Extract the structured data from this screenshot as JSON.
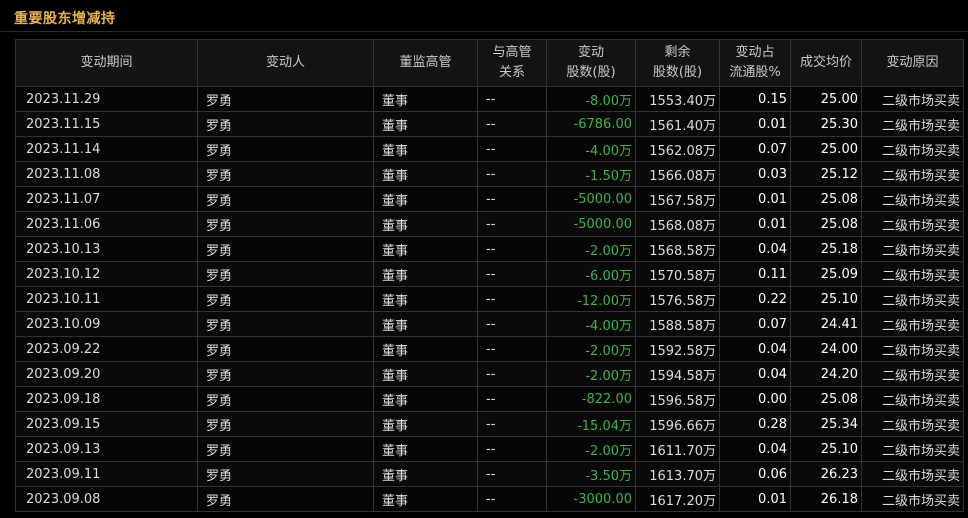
{
  "title": "重要股东增减持",
  "colors": {
    "title": "#e8b44a",
    "decrease": "#3cb54a",
    "text": "#dcdcdc",
    "background": "#000000"
  },
  "columns": [
    {
      "line1": "变动期间",
      "line2": ""
    },
    {
      "line1": "变动人",
      "line2": ""
    },
    {
      "line1": "董监高管",
      "line2": ""
    },
    {
      "line1": "与高管",
      "line2": "关系"
    },
    {
      "line1": "变动",
      "line2": "股数(股)"
    },
    {
      "line1": "剩余",
      "line2": "股数(股)"
    },
    {
      "line1": "变动占",
      "line2": "流通股%"
    },
    {
      "line1": "成交均价",
      "line2": ""
    },
    {
      "line1": "变动原因",
      "line2": ""
    }
  ],
  "rows": [
    {
      "date": "2023.11.29",
      "person": "罗勇",
      "role": "董事",
      "relation": "--",
      "change": "-8.00万",
      "remain": "1553.40万",
      "ratio": "0.15",
      "price": "25.00",
      "reason": "二级市场买卖"
    },
    {
      "date": "2023.11.15",
      "person": "罗勇",
      "role": "董事",
      "relation": "--",
      "change": "-6786.00",
      "remain": "1561.40万",
      "ratio": "0.01",
      "price": "25.30",
      "reason": "二级市场买卖"
    },
    {
      "date": "2023.11.14",
      "person": "罗勇",
      "role": "董事",
      "relation": "--",
      "change": "-4.00万",
      "remain": "1562.08万",
      "ratio": "0.07",
      "price": "25.00",
      "reason": "二级市场买卖"
    },
    {
      "date": "2023.11.08",
      "person": "罗勇",
      "role": "董事",
      "relation": "--",
      "change": "-1.50万",
      "remain": "1566.08万",
      "ratio": "0.03",
      "price": "25.12",
      "reason": "二级市场买卖"
    },
    {
      "date": "2023.11.07",
      "person": "罗勇",
      "role": "董事",
      "relation": "--",
      "change": "-5000.00",
      "remain": "1567.58万",
      "ratio": "0.01",
      "price": "25.08",
      "reason": "二级市场买卖"
    },
    {
      "date": "2023.11.06",
      "person": "罗勇",
      "role": "董事",
      "relation": "--",
      "change": "-5000.00",
      "remain": "1568.08万",
      "ratio": "0.01",
      "price": "25.08",
      "reason": "二级市场买卖"
    },
    {
      "date": "2023.10.13",
      "person": "罗勇",
      "role": "董事",
      "relation": "--",
      "change": "-2.00万",
      "remain": "1568.58万",
      "ratio": "0.04",
      "price": "25.18",
      "reason": "二级市场买卖"
    },
    {
      "date": "2023.10.12",
      "person": "罗勇",
      "role": "董事",
      "relation": "--",
      "change": "-6.00万",
      "remain": "1570.58万",
      "ratio": "0.11",
      "price": "25.09",
      "reason": "二级市场买卖"
    },
    {
      "date": "2023.10.11",
      "person": "罗勇",
      "role": "董事",
      "relation": "--",
      "change": "-12.00万",
      "remain": "1576.58万",
      "ratio": "0.22",
      "price": "25.10",
      "reason": "二级市场买卖"
    },
    {
      "date": "2023.10.09",
      "person": "罗勇",
      "role": "董事",
      "relation": "--",
      "change": "-4.00万",
      "remain": "1588.58万",
      "ratio": "0.07",
      "price": "24.41",
      "reason": "二级市场买卖"
    },
    {
      "date": "2023.09.22",
      "person": "罗勇",
      "role": "董事",
      "relation": "--",
      "change": "-2.00万",
      "remain": "1592.58万",
      "ratio": "0.04",
      "price": "24.00",
      "reason": "二级市场买卖"
    },
    {
      "date": "2023.09.20",
      "person": "罗勇",
      "role": "董事",
      "relation": "--",
      "change": "-2.00万",
      "remain": "1594.58万",
      "ratio": "0.04",
      "price": "24.20",
      "reason": "二级市场买卖"
    },
    {
      "date": "2023.09.18",
      "person": "罗勇",
      "role": "董事",
      "relation": "--",
      "change": "-822.00",
      "remain": "1596.58万",
      "ratio": "0.00",
      "price": "25.08",
      "reason": "二级市场买卖"
    },
    {
      "date": "2023.09.15",
      "person": "罗勇",
      "role": "董事",
      "relation": "--",
      "change": "-15.04万",
      "remain": "1596.66万",
      "ratio": "0.28",
      "price": "25.34",
      "reason": "二级市场买卖"
    },
    {
      "date": "2023.09.13",
      "person": "罗勇",
      "role": "董事",
      "relation": "--",
      "change": "-2.00万",
      "remain": "1611.70万",
      "ratio": "0.04",
      "price": "25.10",
      "reason": "二级市场买卖"
    },
    {
      "date": "2023.09.11",
      "person": "罗勇",
      "role": "董事",
      "relation": "--",
      "change": "-3.50万",
      "remain": "1613.70万",
      "ratio": "0.06",
      "price": "26.23",
      "reason": "二级市场买卖"
    },
    {
      "date": "2023.09.08",
      "person": "罗勇",
      "role": "董事",
      "relation": "--",
      "change": "-3000.00",
      "remain": "1617.20万",
      "ratio": "0.01",
      "price": "26.18",
      "reason": "二级市场买卖"
    }
  ]
}
